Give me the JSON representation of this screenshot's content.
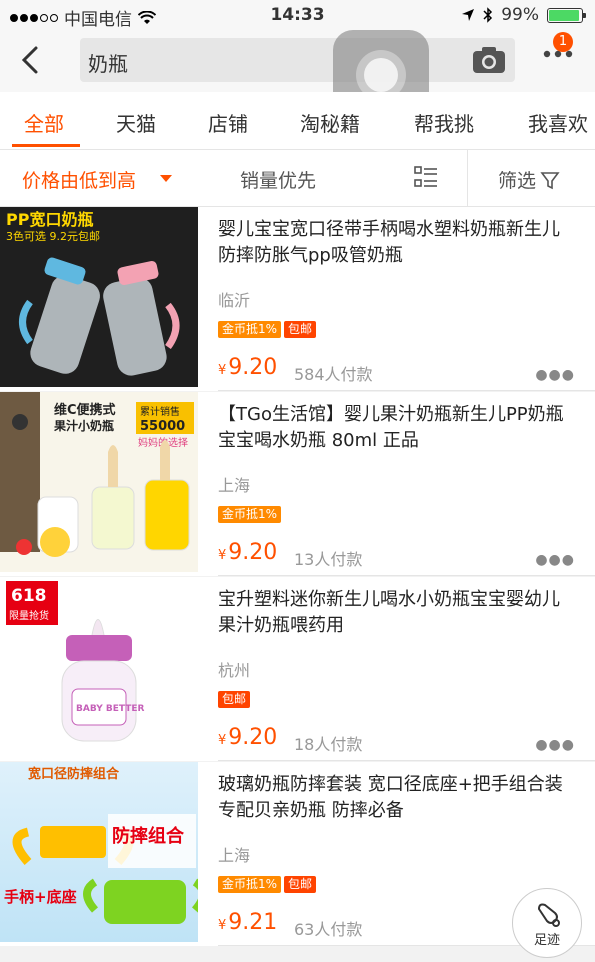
{
  "status_bar": {
    "carrier": "中国电信",
    "time": "14:33",
    "battery": "99%"
  },
  "search": {
    "query": "奶瓶",
    "cart_badge": "1"
  },
  "tabs": [
    "全部",
    "天猫",
    "店铺",
    "淘秘籍",
    "帮我挑",
    "我喜欢"
  ],
  "sort": {
    "price": "价格由低到高",
    "sales": "销量优先",
    "filter": "筛选"
  },
  "items": [
    {
      "title": "婴儿宝宝宽口径带手柄喝水塑料奶瓶新生儿防摔防胀气pp吸管奶瓶",
      "location": "临沂",
      "tags": [
        "金币抵1%",
        "包邮"
      ],
      "price": "9.20",
      "sales": "584人付款",
      "thumb_text": {
        "line1": "PP宽口奶瓶",
        "line2": "3色可选 9.2元包邮"
      }
    },
    {
      "title": "【TGo生活馆】婴儿果汁奶瓶新生儿PP奶瓶 宝宝喝水奶瓶 80ml 正品",
      "location": "上海",
      "tags": [
        "金币抵1%"
      ],
      "price": "9.20",
      "sales": "13人付款",
      "thumb_text": {
        "line1": "维C便携式",
        "line2": "果汁小奶瓶",
        "badge1": "累计销售",
        "badge2": "55000",
        "badge3": "妈妈的选择"
      }
    },
    {
      "title": "宝升塑料迷你新生儿喝水小奶瓶宝宝婴幼儿果汁奶瓶喂药用",
      "location": "杭州",
      "tags": [
        "包邮"
      ],
      "price": "9.20",
      "sales": "18人付款",
      "thumb_text": {
        "line1": "618",
        "line2": "限量抢货",
        "brand": "BABY BETTER"
      }
    },
    {
      "title": "玻璃奶瓶防摔套装 宽口径底座+把手组合装 专配贝亲奶瓶 防摔必备",
      "location": "上海",
      "tags": [
        "金币抵1%",
        "包邮"
      ],
      "price": "9.21",
      "sales": "63人付款",
      "thumb_text": {
        "line1": "宽口径防摔组合",
        "line2": "防摔组合",
        "line3": "手柄+底座"
      }
    }
  ],
  "currency": "¥",
  "footprint": "足迹",
  "colors": {
    "accent": "#ff5000",
    "coin_tag": "#ff8a00",
    "free_tag": "#ff4400"
  }
}
